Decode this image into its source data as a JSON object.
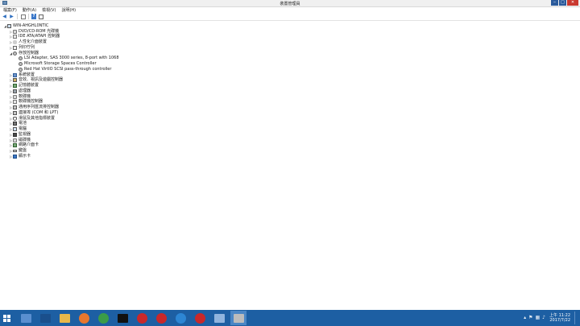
{
  "window": {
    "title": "裝置管理員"
  },
  "controls": {
    "minimize": "‒",
    "maximize": "□",
    "close": "✕"
  },
  "menu": [
    "檔案(F)",
    "動作(A)",
    "檢視(V)",
    "說明(H)"
  ],
  "toolbar": {
    "back_icon": "arrow-left-icon",
    "forward_icon": "arrow-right-icon",
    "help_glyph": "?"
  },
  "tree": [
    {
      "label": "WIN-AHGHL0NTIC",
      "icon": "computer",
      "indent": 0,
      "expander": "◢"
    },
    {
      "label": "DVD/CD-ROM 光碟機",
      "icon": "disk",
      "indent": 1,
      "expander": "▷"
    },
    {
      "label": "IDE ATA/ATAPI 控制器",
      "icon": "device",
      "indent": 1,
      "expander": "▷"
    },
    {
      "label": "人性化介面裝置",
      "icon": "hid",
      "indent": 1,
      "expander": "▷"
    },
    {
      "label": "列印佇列",
      "icon": "printer",
      "indent": 1,
      "expander": "▷"
    },
    {
      "label": "存放控制器",
      "icon": "storage",
      "indent": 1,
      "expander": "◢"
    },
    {
      "label": "LSI Adapter, SAS 3000 series, 8-port with 1068",
      "icon": "storage",
      "indent": 2,
      "expander": ""
    },
    {
      "label": "Microsoft Storage Spaces Controller",
      "icon": "storage",
      "indent": 2,
      "expander": ""
    },
    {
      "label": "Red Hat VirtIO SCSI pass-through controller",
      "icon": "storage",
      "indent": 2,
      "expander": ""
    },
    {
      "label": "系統裝置",
      "icon": "sys",
      "indent": 1,
      "expander": "▷"
    },
    {
      "label": "音效、視訊及遊戲控制器",
      "icon": "audio",
      "indent": 1,
      "expander": "▷"
    },
    {
      "label": "記憶體裝置",
      "icon": "net",
      "indent": 1,
      "expander": "▷"
    },
    {
      "label": "處理器",
      "icon": "cpu",
      "indent": 1,
      "expander": "▷"
    },
    {
      "label": "軟碟機",
      "icon": "disk",
      "indent": 1,
      "expander": "▷"
    },
    {
      "label": "軟碟機控制器",
      "icon": "device",
      "indent": 1,
      "expander": "▷"
    },
    {
      "label": "通用序列匯流排控制器",
      "icon": "port",
      "indent": 1,
      "expander": "▷"
    },
    {
      "label": "連接埠 (COM 和 LPT)",
      "icon": "port",
      "indent": 1,
      "expander": "▷"
    },
    {
      "label": "滑鼠及其他指標裝置",
      "icon": "mouse",
      "indent": 1,
      "expander": "▷"
    },
    {
      "label": "電池",
      "icon": "firmware",
      "indent": 1,
      "expander": "▷"
    },
    {
      "label": "電腦",
      "icon": "computer",
      "indent": 1,
      "expander": "▷"
    },
    {
      "label": "監視器",
      "icon": "monitor",
      "indent": 1,
      "expander": "▷"
    },
    {
      "label": "磁碟機",
      "icon": "disk",
      "indent": 1,
      "expander": "▷"
    },
    {
      "label": "網路介面卡",
      "icon": "net",
      "indent": 1,
      "expander": "▷"
    },
    {
      "label": "鍵盤",
      "icon": "keyboard",
      "indent": 1,
      "expander": "▷"
    },
    {
      "label": "顯示卡",
      "icon": "display",
      "indent": 1,
      "expander": "▷"
    }
  ],
  "taskbar": {
    "apps": [
      {
        "name": "server-manager",
        "color": "#5a8fd0"
      },
      {
        "name": "powershell",
        "color": "#1a4f8c"
      },
      {
        "name": "file-explorer",
        "color": "#e8b84a"
      },
      {
        "name": "firefox",
        "color": "#e8772e"
      },
      {
        "name": "chrome",
        "color": "#3b9c48"
      },
      {
        "name": "terminal",
        "color": "#111111"
      },
      {
        "name": "app-red-1",
        "color": "#c9282a"
      },
      {
        "name": "app-red-2",
        "color": "#c9282a"
      },
      {
        "name": "internet-explorer",
        "color": "#2d86d4"
      },
      {
        "name": "app-red-3",
        "color": "#c9282a"
      },
      {
        "name": "network",
        "color": "#8fb4de"
      },
      {
        "name": "device-manager",
        "color": "#bcbcbc"
      }
    ],
    "clock_time": "上午 11:22",
    "clock_date": "2017/7/22"
  },
  "colors": {
    "titlebar": "#f0f0f0",
    "taskbar": "#1d5fa3",
    "close": "#c9392f"
  }
}
